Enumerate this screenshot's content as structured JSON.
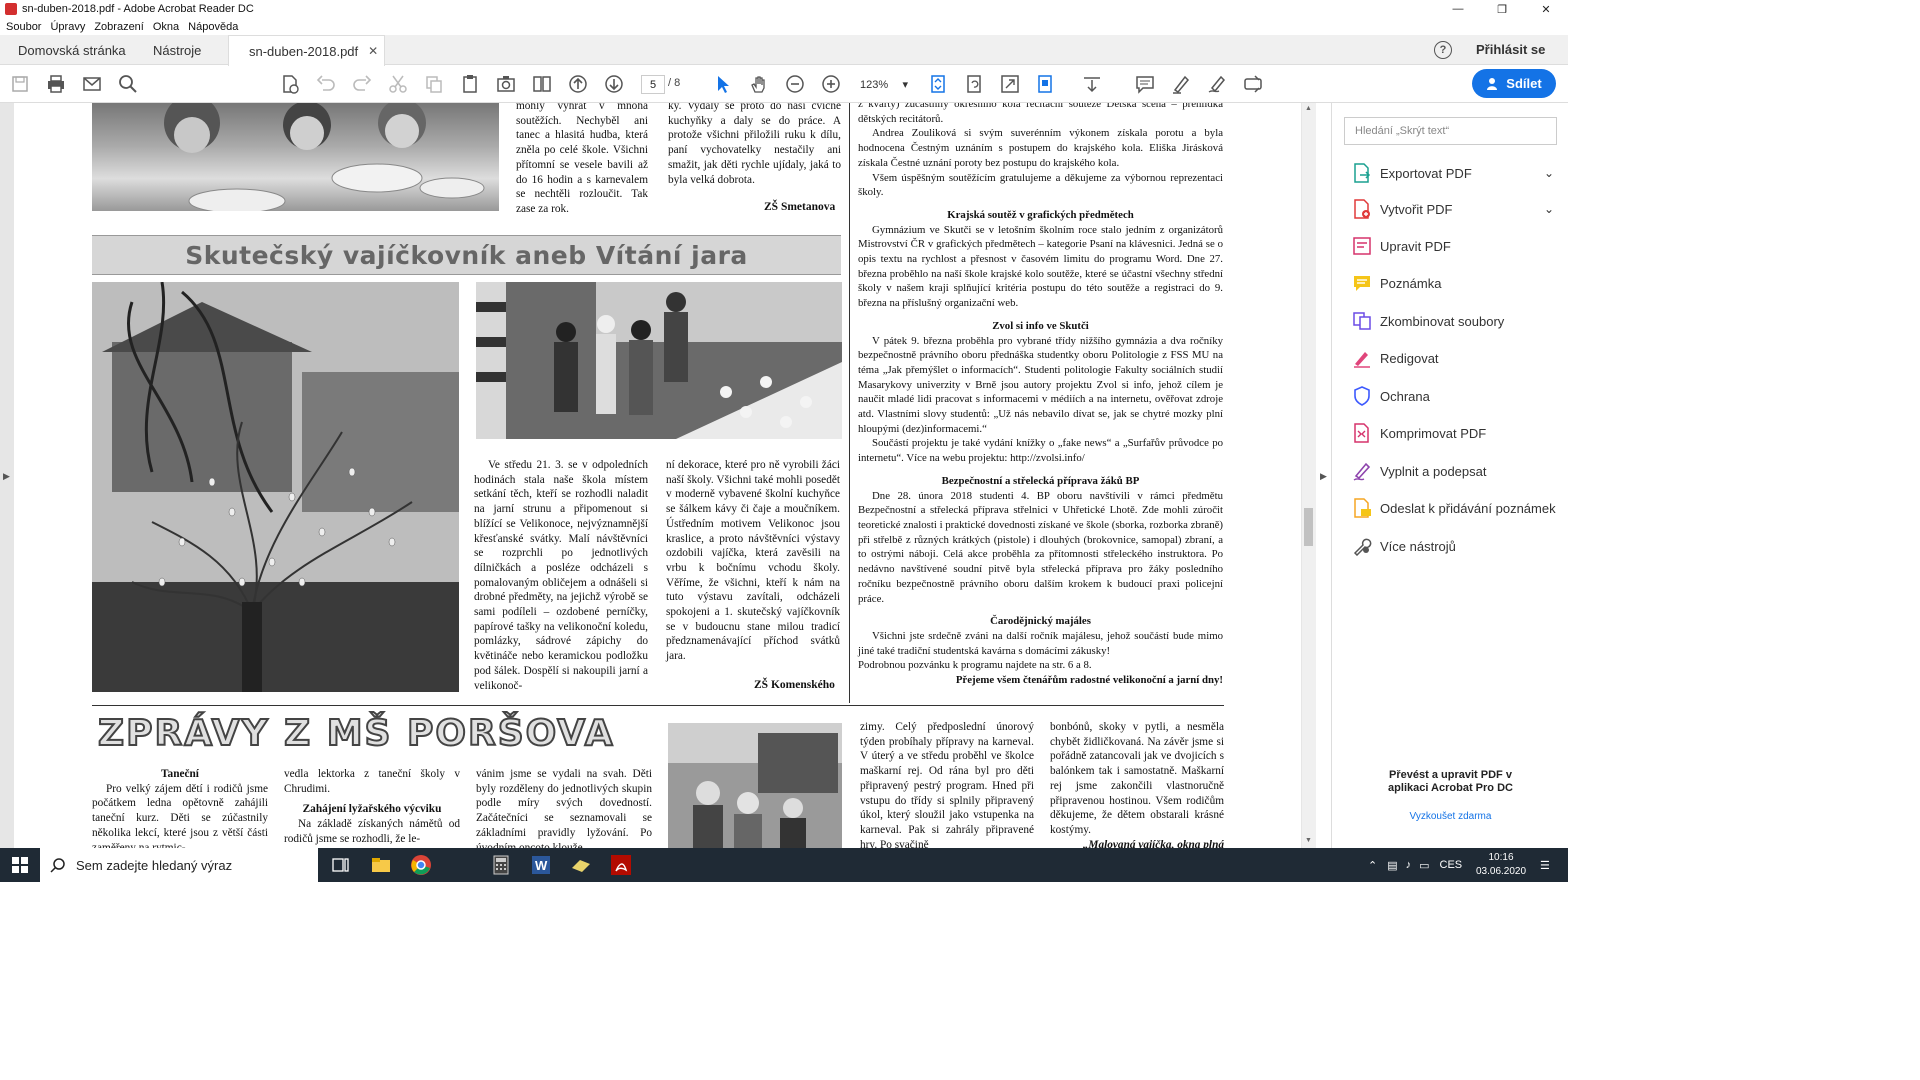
{
  "window": {
    "title": "sn-duben-2018.pdf - Adobe Acrobat Reader DC"
  },
  "menu": [
    "Soubor",
    "Úpravy",
    "Zobrazení",
    "Okna",
    "Nápověda"
  ],
  "tabs": {
    "home": "Domovská stránka",
    "tools": "Nástroje",
    "doc": "sn-duben-2018.pdf",
    "close": "✕"
  },
  "header": {
    "signin": "Přihlásit se",
    "help": "?"
  },
  "toolbar": {
    "page_current": "5",
    "page_total": "/ 8",
    "zoom": "123%",
    "share": "Sdílet"
  },
  "right_panel": {
    "search_placeholder": "Hledání „Skrýt text“",
    "tools": [
      "Exportovat PDF",
      "Vytvořit PDF",
      "Upravit PDF",
      "Poznámka",
      "Zkombinovat soubory",
      "Redigovat",
      "Ochrana",
      "Komprimovat PDF",
      "Vyplnit a podepsat",
      "Odeslat k přidávání poznámek",
      "Více nástrojů"
    ],
    "promo": "Převést a upravit PDF v aplikaci Acrobat Pro DC",
    "try": "Vyzkoušet zdarma"
  },
  "taskbar": {
    "search": "Sem zadejte hledaný výraz",
    "lang": "CES",
    "time": "10:16",
    "date": "03.06.2020"
  },
  "doc": {
    "top_col1": "mohly vyhrát v mnoha soutěžích. Nechyběl ani tanec a hlasitá hudba, která zněla po celé škole. Všichni přítomní se vesele bavili až do 16 hodin a s karnevalem se nechtěli rozloučit. Tak zase za rok.",
    "top_col2": "ky. Vydaly se proto do naší cvičné kuchyňky a daly se do práce. A protože všichni přiložili ruku k dílu, paní vychovatelky nestačily ani smažit, jak děti rychle ujídaly, jaká to byla velká dobrota.",
    "sig_smetanova": "ZŠ Smetanova",
    "banner": "Skutečský vajíčkovník aneb Vítání jara",
    "vaj_col1": "Ve středu 21. 3. se v odpoledních hodinách stala naše škola místem setkání těch, kteří se rozhodli naladit na jarní strunu a připomenout si blížící se Velikonoce, nejvýznamnější křesťanské svátky. Malí návštěvníci se rozprchli po jednotlivých dílničkách a posléze odcházeli s pomalovaným obličejem a odnášeli si drobné předměty, na jejichž výrobě se sami podíleli – ozdobené perníčky, papírové tašky na velikonoční koledu, pomlázky, sádrové zápichy do květináče nebo keramickou podložku pod šálek. Dospělí si nakoupili jarní a velikonoč-",
    "vaj_col2": "ní dekorace, které pro ně vyrobili žáci naší školy. Všichni také mohli posedět v moderně vybavené školní kuchyňce se šálkem kávy či čaje a moučníkem. Ústředním motivem Velikonoc jsou kraslice, a proto návštěvníci výstavy ozdobili vajíčka, která zavěsili na vrbu k bočnímu vchodu školy. Věříme, že všichni, kteří k nám na tuto výstavu zavítali, odcházeli spokojeni a 1. skutečský vajíčkovník se v budoucnu stane milou tradicí předznamenávající příchod svátků jara.",
    "sig_komenskeho": "ZŠ Komenského",
    "r_intro": "z kvarty) zúčastnily okresního kola recitační soutěže Dětská scéna – přehlídka dětských recitátorů.",
    "r_p1": "Andrea Zouliková si svým suverénním výkonem získala porotu a byla hodnocena Čestným uznáním s postupem do krajského kola. Eliška Jirásková získala Čestné uznání poroty bez postupu do krajského kola.",
    "r_p2": "Všem úspěšným soutěžícím gratulujeme a děkujeme za výbornou reprezentaci školy.",
    "r_h1": "Krajská soutěž v grafických předmětech",
    "r_p3": "Gymnázium ve Skutči se v letošním školním roce stalo jedním z organizátorů Mistrovství ČR v grafických předmětech – kategorie Psaní na klávesnici. Jedná se o opis textu na rychlost a přesnost v časovém limitu do programu Word. Dne 27. března proběhlo na naší škole krajské kolo soutěže, které se účastní všechny střední školy v našem kraji splňující kritéria postupu do této soutěže a registraci do 9. března na příslušný organizační web.",
    "r_h2": "Zvol si info ve Skutči",
    "r_p4": "V pátek 9. března proběhla pro vybrané třídy nižšího gymnázia a dva ročníky bezpečnostně právního oboru přednáška studentky oboru Politologie z FSS MU na téma „Jak přemýšlet o informacích“. Studenti politologie Fakulty sociálních studií Masarykovy univerzity v Brně jsou autory projektu Zvol si info, jehož cílem je naučit mladé lidi pracovat s informacemi v médiích a na internetu, ověřovat zdroje atd. Vlastními slovy studentů: „Už nás nebavilo dívat se, jak se chytré mozky plní hloupými (dez)informacemi.“",
    "r_p5": "Součástí projektu je také vydání knížky o „fake news“ a „Surfařův průvodce po internetu“. Více na webu projektu: http://zvolsi.info/",
    "r_h3": "Bezpečnostní a střelecká příprava žáků BP",
    "r_p6": "Dne 28. února 2018 studenti 4. BP oboru navštívili v rámci předmětu Bezpečnostní a střelecká příprava střelnici v Uhřetické Lhotě. Zde mohli zúročit teoretické znalosti i praktické dovednosti získané ve škole (sborka, rozborka zbraně) při střelbě z různých krátkých (pistole) i dlouhých (brokovnice, samopal) zbraní, a to ostrými náboji. Celá akce proběhla za přítomnosti střeleckého instruktora. Po nedávno navštívené soudní pitvě byla střelecká příprava pro žáky posledního ročníku bezpečnostně právního oboru dalším krokem k budoucí praxi policejní práce.",
    "r_h4": "Čarodějnický majáles",
    "r_p7": "Všichni jste srdečně zváni na další ročník majálesu, jehož součástí bude mimo jiné také tradiční studentská kavárna s domácími zákusky!",
    "r_p8": "Podrobnou pozvánku k programu najdete na str. 6 a 8.",
    "r_final": "Přejeme všem čtenářům radostné velikonoční a jarní dny!",
    "ms_title": "ZPRÁVY Z MŠ PORŠOVA",
    "ms_h1": "Taneční",
    "ms_c1": "Pro velký zájem dětí i rodičů jsme počátkem ledna opětovně zahájili taneční kurz. Děti se zúčastnily několika lekcí, které jsou z větší části zaměřeny na rytmic-",
    "ms_c2a": "vedla lektorka z taneční školy v Chrudimi.",
    "ms_h2": "Zahájení lyžařského výcviku",
    "ms_c2b": "Na základě získaných námětů od rodičů jsme se rozhodli, že le-",
    "ms_c3": "vánim jsme se vydali na svah. Děti byly rozděleny do jednotlivých skupin podle míry svých dovedností. Začátečníci se seznamovali se základními pravidly lyžování. Po úvodním oncoto klouže",
    "ms_c4": "zimy. Celý předposlední únorový týden probíhaly přípravy na karneval. V úterý a ve středu proběhl ve školce maškarní rej. Od rána byl pro děti připravený pestrý program. Hned při vstupu do třídy si splnily připravený úkol, který sloužil jako vstupenka na karneval. Pak si zahrály připravené hry. Po svačině",
    "ms_c5": "bonbónů, skoky v pytli, a nesměla chybět židličkovaná. Na závěr jsme si pořádně zatancovali jak ve dvojicích s balónkem tak i samostatně. Maškarní rej jsme zakončili vlastnoručně připravenou hostinou. Všem rodičům děkujeme, že dětem obstarali krásné kostýmy.",
    "ms_c5b": "„Malovaná vajíčka, okna plná"
  }
}
